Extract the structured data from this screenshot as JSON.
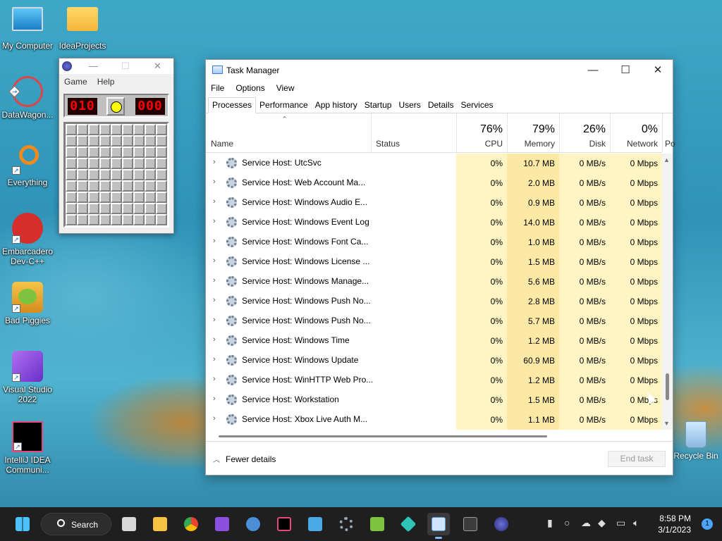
{
  "desktop": {
    "icons": [
      {
        "label": "My Computer"
      },
      {
        "label": "IdeaProjects"
      },
      {
        "label": "DataWagon..."
      },
      {
        "label": "Everything"
      },
      {
        "label": "Embarcadero Dev-C++"
      },
      {
        "label": "Bad Piggies"
      },
      {
        "label": "Visual Studio 2022"
      },
      {
        "label": "IntelliJ IDEA Communi..."
      },
      {
        "label": "Recycle Bin"
      }
    ]
  },
  "minesweeper": {
    "menu": [
      "Game",
      "Help"
    ],
    "mine_counter": "010",
    "timer": "000",
    "colors": {
      "lcd_text": "#ff0000",
      "lcd_bg": "#220000"
    }
  },
  "task_manager": {
    "title": "Task Manager",
    "menu": [
      "File",
      "Options",
      "View"
    ],
    "tabs": [
      "Processes",
      "Performance",
      "App history",
      "Startup",
      "Users",
      "Details",
      "Services"
    ],
    "active_tab": "Processes",
    "columns": {
      "name": "Name",
      "status": "Status",
      "cpu": {
        "pct": "76%",
        "label": "CPU"
      },
      "memory": {
        "pct": "79%",
        "label": "Memory"
      },
      "disk": {
        "pct": "26%",
        "label": "Disk"
      },
      "network": {
        "pct": "0%",
        "label": "Network"
      },
      "power": "Po"
    },
    "rows": [
      {
        "name": "Service Host: UtcSvc",
        "cpu": "0%",
        "mem": "10.7 MB",
        "disk": "0 MB/s",
        "net": "0 Mbps"
      },
      {
        "name": "Service Host: Web Account Ma...",
        "cpu": "0%",
        "mem": "2.0 MB",
        "disk": "0 MB/s",
        "net": "0 Mbps"
      },
      {
        "name": "Service Host: Windows Audio E...",
        "cpu": "0%",
        "mem": "0.9 MB",
        "disk": "0 MB/s",
        "net": "0 Mbps"
      },
      {
        "name": "Service Host: Windows Event Log",
        "cpu": "0%",
        "mem": "14.0 MB",
        "disk": "0 MB/s",
        "net": "0 Mbps"
      },
      {
        "name": "Service Host: Windows Font Ca...",
        "cpu": "0%",
        "mem": "1.0 MB",
        "disk": "0 MB/s",
        "net": "0 Mbps"
      },
      {
        "name": "Service Host: Windows License ...",
        "cpu": "0%",
        "mem": "1.5 MB",
        "disk": "0 MB/s",
        "net": "0 Mbps"
      },
      {
        "name": "Service Host: Windows Manage...",
        "cpu": "0%",
        "mem": "5.6 MB",
        "disk": "0 MB/s",
        "net": "0 Mbps"
      },
      {
        "name": "Service Host: Windows Push No...",
        "cpu": "0%",
        "mem": "2.8 MB",
        "disk": "0 MB/s",
        "net": "0 Mbps"
      },
      {
        "name": "Service Host: Windows Push No...",
        "cpu": "0%",
        "mem": "5.7 MB",
        "disk": "0 MB/s",
        "net": "0 Mbps"
      },
      {
        "name": "Service Host: Windows Time",
        "cpu": "0%",
        "mem": "1.2 MB",
        "disk": "0 MB/s",
        "net": "0 Mbps"
      },
      {
        "name": "Service Host: Windows Update",
        "cpu": "0%",
        "mem": "60.9 MB",
        "disk": "0 MB/s",
        "net": "0 Mbps"
      },
      {
        "name": "Service Host: WinHTTP Web Pro...",
        "cpu": "0%",
        "mem": "1.2 MB",
        "disk": "0 MB/s",
        "net": "0 Mbps"
      },
      {
        "name": "Service Host: Workstation",
        "cpu": "0%",
        "mem": "1.5 MB",
        "disk": "0 MB/s",
        "net": "0 Mbps"
      },
      {
        "name": "Service Host: Xbox Live Auth M...",
        "cpu": "0%",
        "mem": "1.1 MB",
        "disk": "0 MB/s",
        "net": "0 Mbps"
      }
    ],
    "footer": {
      "fewer_details": "Fewer details",
      "end_task": "End task"
    },
    "colors": {
      "heat_light": "#fff4c4",
      "heat_mid": "#fce9a5"
    }
  },
  "taskbar": {
    "search_label": "Search",
    "pinned": [
      "start-icon",
      "task-view-icon",
      "file-explorer-icon",
      "chrome-icon",
      "visual-studio-icon",
      "qbittorrent-icon",
      "intellij-icon",
      "notepad-icon",
      "settings-icon",
      "bad-piggies-icon",
      "app-icon",
      "task-manager-icon",
      "terminal-icon",
      "minesweeper-icon"
    ],
    "active_app": "task-manager-icon",
    "clock_time": "8:58 PM",
    "clock_date": "3/1/2023",
    "notification_count": "1"
  }
}
